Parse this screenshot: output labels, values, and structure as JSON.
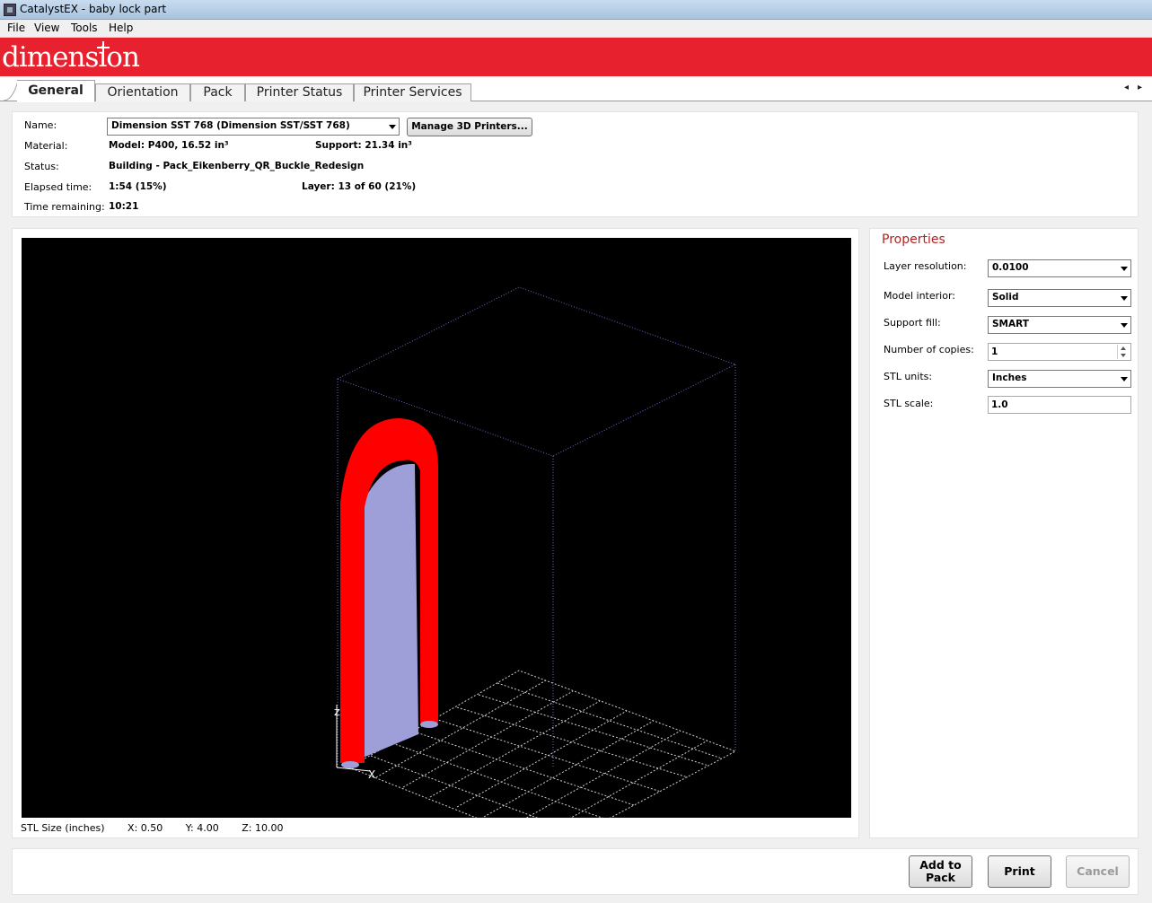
{
  "window": {
    "title": "CatalystEX - baby lock part"
  },
  "menu": {
    "items": [
      "File",
      "View",
      "Tools",
      "Help"
    ]
  },
  "brand": {
    "logo_text": "dimension",
    "color": "#e8212f"
  },
  "tabs": [
    {
      "label": "General",
      "active": true
    },
    {
      "label": "Orientation",
      "active": false
    },
    {
      "label": "Pack",
      "active": false
    },
    {
      "label": "Printer Status",
      "active": false
    },
    {
      "label": "Printer Services",
      "active": false
    }
  ],
  "tab_scroll": {
    "left": "◂",
    "right": "▸"
  },
  "info": {
    "name_label": "Name:",
    "printer_selected": "Dimension SST 768  (Dimension SST/SST 768)",
    "manage_button": "Manage 3D Printers...",
    "material_label": "Material:",
    "model_material": "Model: P400, 16.52 in³",
    "support_material": "Support:  21.34 in³",
    "status_label": "Status:",
    "status_value": "Building  -  Pack_Eikenberry_QR_Buckle_Redesign",
    "elapsed_label": "Elapsed time:",
    "elapsed_value": "1:54  (15%)",
    "layer_value": "Layer: 13 of 60  (21%)",
    "remaining_label": "Time remaining:",
    "remaining_value": "10:21"
  },
  "viewport": {
    "model_color": "#ff0000",
    "support_color": "#9e9ed8",
    "axis_labels": {
      "x": "X",
      "z": "Z"
    }
  },
  "stl_size": {
    "label": "STL Size (inches)",
    "x": "X:  0.50",
    "y": "Y:  4.00",
    "z": "Z:  10.00"
  },
  "properties": {
    "title": "Properties",
    "layer_resolution_label": "Layer resolution:",
    "layer_resolution_value": "0.0100",
    "model_interior_label": "Model interior:",
    "model_interior_value": "Solid",
    "support_fill_label": "Support fill:",
    "support_fill_value": "SMART",
    "copies_label": "Number of copies:",
    "copies_value": "1",
    "stl_units_label": "STL units:",
    "stl_units_value": "Inches",
    "stl_scale_label": "STL scale:",
    "stl_scale_value": "1.0"
  },
  "actions": {
    "add_to_pack_line1": "Add to",
    "add_to_pack_line2": "Pack",
    "print": "Print",
    "cancel": "Cancel"
  }
}
